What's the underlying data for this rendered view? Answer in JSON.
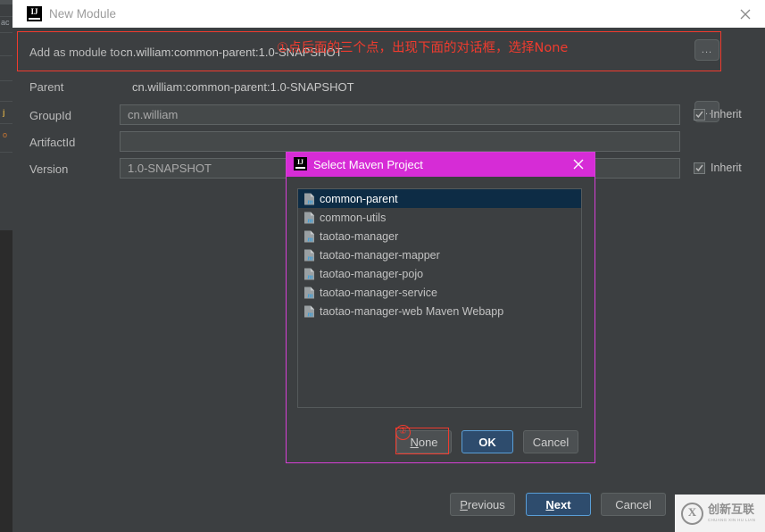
{
  "background_ide": {
    "fragments": [
      "ac",
      "j",
      "o"
    ]
  },
  "window": {
    "title": "New Module",
    "icon": "intellij-idea-icon",
    "close_icon": "close-icon",
    "form": {
      "rows": [
        {
          "label": "Add as module to",
          "value": "cn.william:common-parent:1.0-SNAPSHOT",
          "button": "..."
        },
        {
          "label": "Parent",
          "value": "cn.william:common-parent:1.0-SNAPSHOT",
          "button": "..."
        }
      ],
      "fields": [
        {
          "label": "GroupId",
          "value": "cn.william",
          "inherit_label": "Inherit",
          "inherit_checked": true
        },
        {
          "label": "ArtifactId",
          "value": "",
          "inherit_label": "",
          "inherit_checked": false
        },
        {
          "label": "Version",
          "value": "1.0-SNAPSHOT",
          "inherit_label": "Inherit",
          "inherit_checked": true
        }
      ]
    },
    "wizard_buttons": [
      {
        "label": "Previous",
        "mnemonic": "P",
        "primary": false
      },
      {
        "label": "Next",
        "mnemonic": "N",
        "primary": true
      },
      {
        "label": "Cancel",
        "mnemonic": "",
        "primary": false
      }
    ]
  },
  "annotations": {
    "step1_text": "①点后面的三个点，出现下面的对话框，选择None",
    "step2_marker": "②",
    "color": "#f03b2e"
  },
  "maven_dialog": {
    "title": "Select Maven Project",
    "icon": "intellij-idea-icon",
    "close_icon": "close-icon",
    "accent_color": "#d62cd6",
    "items": [
      {
        "name": "common-parent",
        "selected": true
      },
      {
        "name": "common-utils",
        "selected": false
      },
      {
        "name": "taotao-manager",
        "selected": false
      },
      {
        "name": "taotao-manager-mapper",
        "selected": false
      },
      {
        "name": "taotao-manager-pojo",
        "selected": false
      },
      {
        "name": "taotao-manager-service",
        "selected": false
      },
      {
        "name": "taotao-manager-web Maven Webapp",
        "selected": false
      }
    ],
    "buttons": [
      {
        "label": "None",
        "mnemonic": "N",
        "primary": false
      },
      {
        "label": "OK",
        "mnemonic": "",
        "primary": true
      },
      {
        "label": "Cancel",
        "mnemonic": "",
        "primary": false
      }
    ]
  },
  "watermark": {
    "glyph": "X",
    "chinese": "创新互联",
    "pinyin": "CHUANG XIN HU LIAN"
  }
}
